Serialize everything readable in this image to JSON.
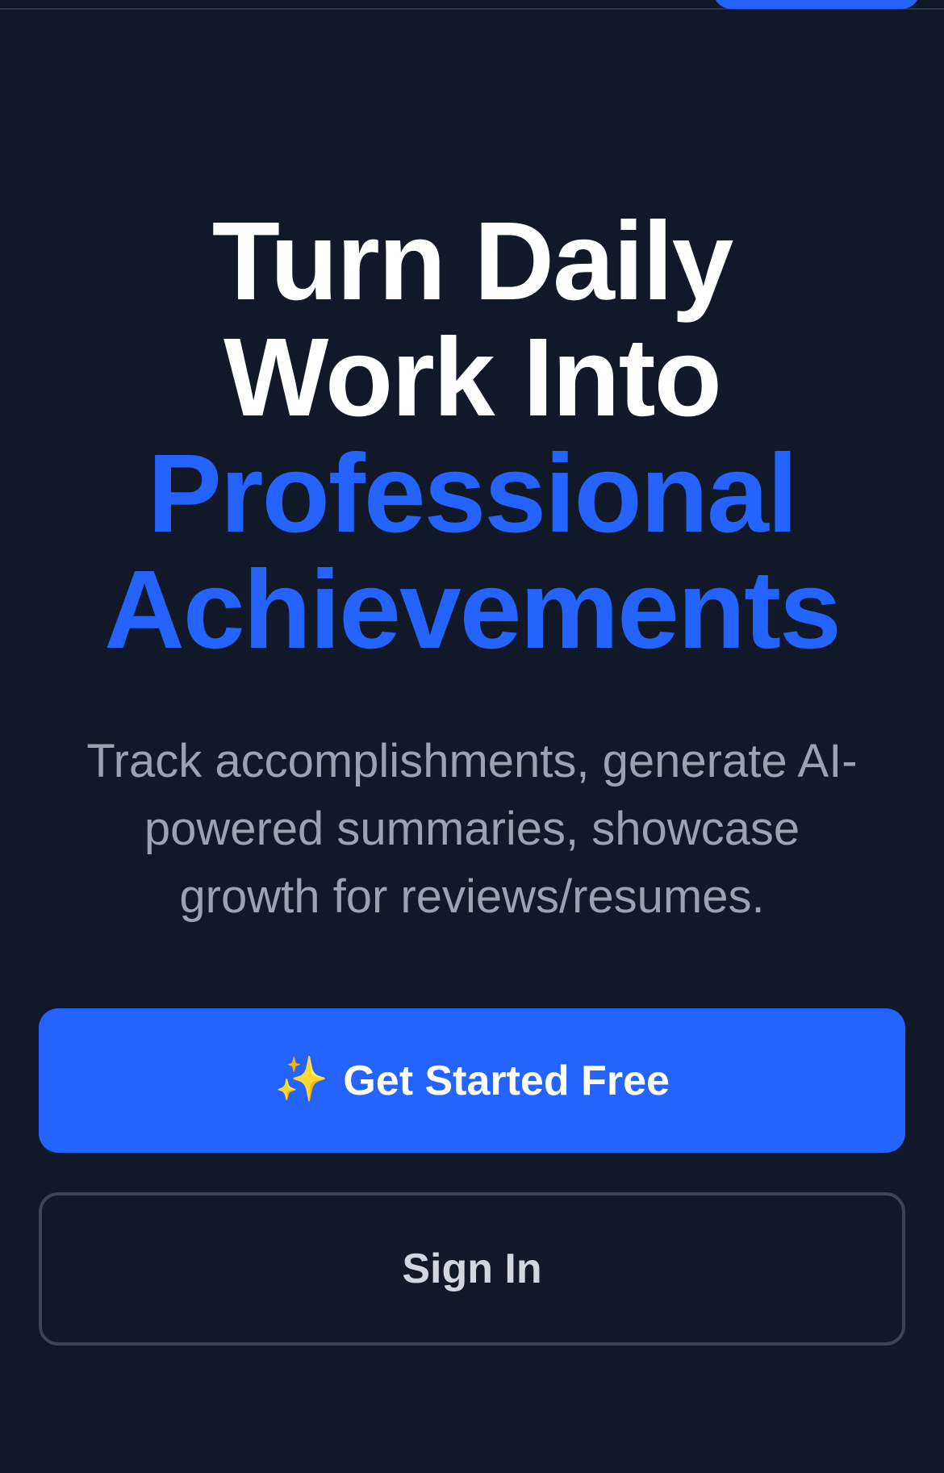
{
  "hero": {
    "headline": {
      "line1": "Turn Daily",
      "line2": "Work Into",
      "line3": "Professional",
      "line4": "Achievements"
    },
    "subtitle": {
      "line1": "Track accomplishments, generate AI-",
      "line2": "powered summaries, showcase",
      "line3": "growth for reviews/resumes."
    }
  },
  "actions": {
    "primary_icon": "✨",
    "primary_label": "Get Started Free",
    "secondary_label": "Sign In"
  },
  "colors": {
    "background": "#111827",
    "accent": "#2563ff",
    "headline": "#ffffff",
    "subtitle": "#9aa3b2",
    "secondary_border": "#3b4556"
  },
  "icons": {
    "primary": "sparkles-icon"
  }
}
